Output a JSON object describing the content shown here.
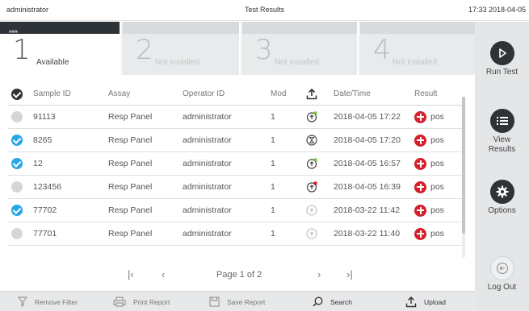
{
  "header": {
    "user": "administrator",
    "title": "Test Results",
    "clock": "17:33 2018-04-05"
  },
  "modules": [
    {
      "number": "1",
      "label": "Available",
      "tag": "■■■"
    },
    {
      "number": "2",
      "label": "Not installed"
    },
    {
      "number": "3",
      "label": "Not installed"
    },
    {
      "number": "4",
      "label": "Not installed"
    }
  ],
  "table": {
    "columns": [
      "Sample ID",
      "Assay",
      "Operator ID",
      "Mod",
      "Date/Time",
      "Result"
    ],
    "rows": [
      {
        "checked": false,
        "sample_id": "91113",
        "assay": "Resp Panel",
        "operator": "administrator",
        "mod": "1",
        "upload_icon": "upload-pending-green-icon",
        "datetime": "2018-04-05 17:22",
        "result": "pos"
      },
      {
        "checked": true,
        "sample_id": "8265",
        "assay": "Resp Panel",
        "operator": "administrator",
        "mod": "1",
        "upload_icon": "hourglass-icon",
        "datetime": "2018-04-05 17:20",
        "result": "pos"
      },
      {
        "checked": true,
        "sample_id": "12",
        "assay": "Resp Panel",
        "operator": "administrator",
        "mod": "1",
        "upload_icon": "upload-pending-green-icon",
        "datetime": "2018-04-05 16:57",
        "result": "pos"
      },
      {
        "checked": false,
        "sample_id": "123456",
        "assay": "Resp Panel",
        "operator": "administrator",
        "mod": "1",
        "upload_icon": "upload-failed-red-icon",
        "datetime": "2018-04-05 16:39",
        "result": "pos"
      },
      {
        "checked": true,
        "sample_id": "77702",
        "assay": "Resp Panel",
        "operator": "administrator",
        "mod": "1",
        "upload_icon": "uploaded-icon",
        "datetime": "2018-03-22 11:42",
        "result": "pos"
      },
      {
        "checked": false,
        "sample_id": "77701",
        "assay": "Resp Panel",
        "operator": "administrator",
        "mod": "1",
        "upload_icon": "uploaded-icon",
        "datetime": "2018-03-22 11:40",
        "result": "pos"
      }
    ]
  },
  "pager": {
    "text": "Page 1 of 2"
  },
  "toolbar": {
    "remove_filter": "Remove Filter",
    "print_report": "Print Report",
    "save_report": "Save Report",
    "search": "Search",
    "upload": "Upload"
  },
  "sidebar": {
    "run_test": "Run Test",
    "view_results": "View Results",
    "options": "Options",
    "log_out": "Log Out"
  },
  "colors": {
    "accent_blue": "#29a6e8",
    "positive_red": "#d61f2b",
    "dark": "#2e3337"
  }
}
